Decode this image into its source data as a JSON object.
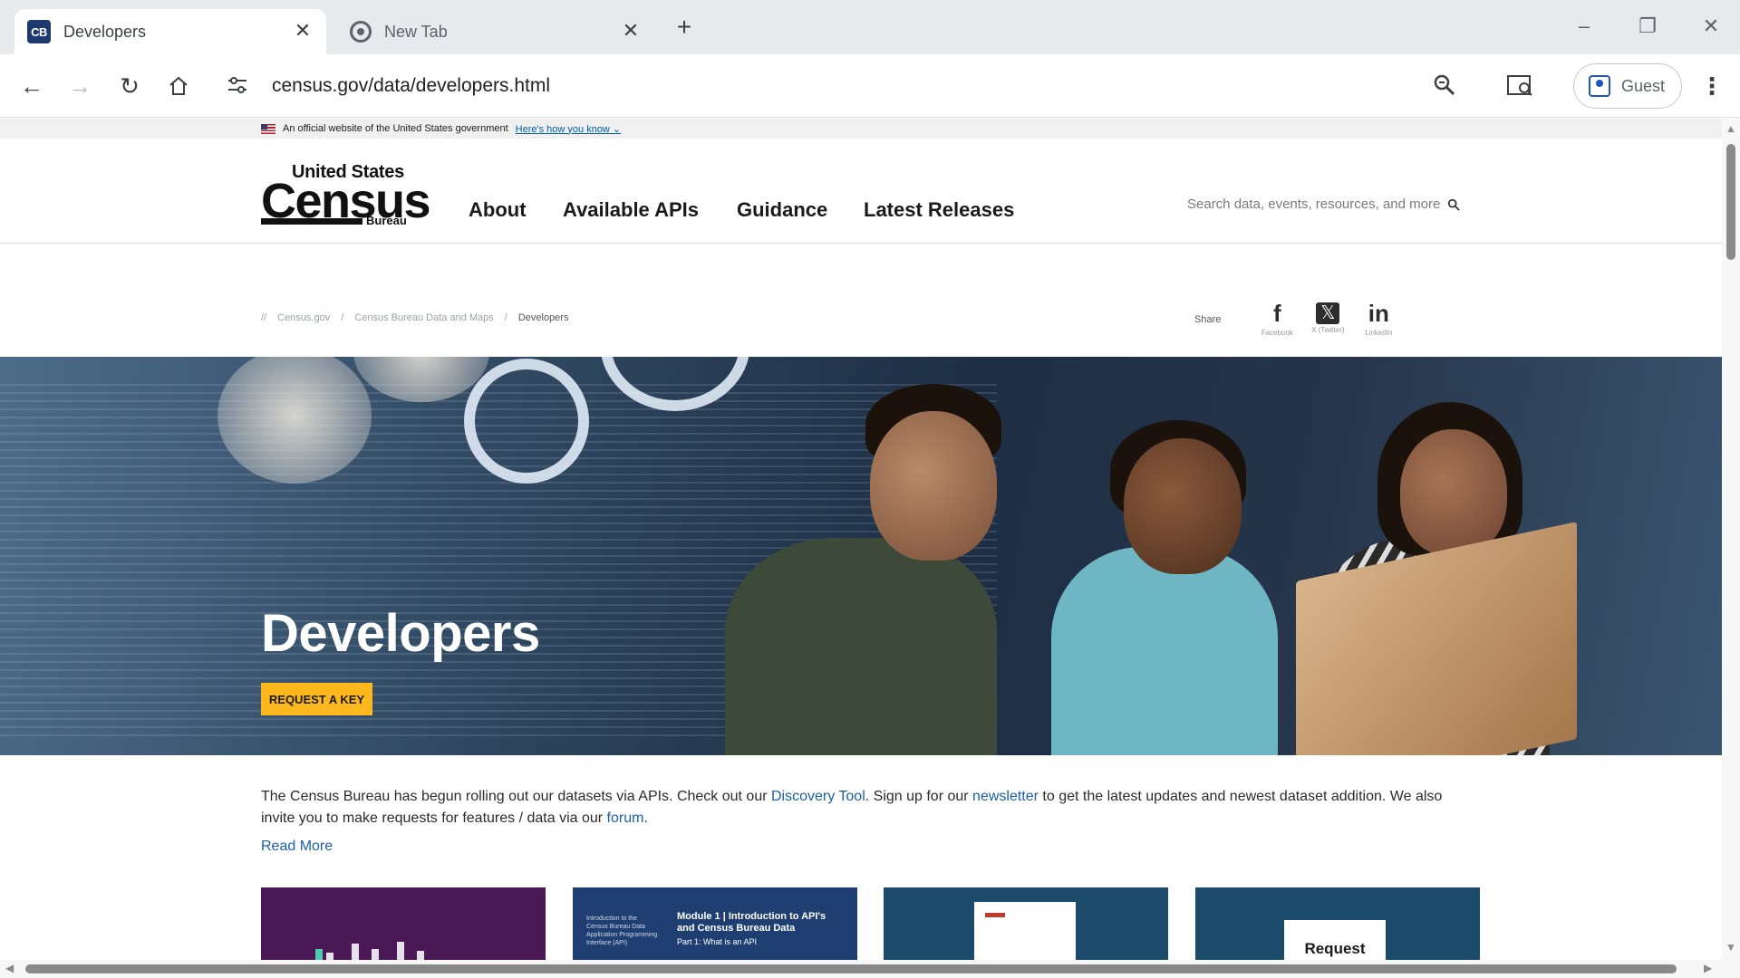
{
  "browser": {
    "tabs": [
      {
        "title": "Developers",
        "favicon": "CB",
        "active": true
      },
      {
        "title": "New Tab",
        "favicon": "chrome-icon",
        "active": false
      }
    ],
    "url": "census.gov/data/developers.html",
    "profile_label": "Guest",
    "colors": {
      "tabstrip": "#e6eaed",
      "accent": "#1a56c4"
    }
  },
  "gov_banner": {
    "text": "An official website of the United States government",
    "link": "Here's how you know ⌄"
  },
  "logo": {
    "line1": "United States",
    "line2": "Census",
    "line3": "Bureau"
  },
  "nav": [
    "About",
    "Available APIs",
    "Guidance",
    "Latest Releases"
  ],
  "search": {
    "placeholder": "Search data, events, resources, and more"
  },
  "breadcrumb": {
    "home_glyph": "//",
    "items": [
      "Census.gov",
      "Census Bureau Data and Maps",
      "Developers"
    ]
  },
  "share": {
    "label": "Share",
    "items": [
      {
        "glyph": "f",
        "label": "Facebook"
      },
      {
        "glyph": "𝕏",
        "label": "X (Twitter)"
      },
      {
        "glyph": "in",
        "label": "LinkedIn"
      }
    ]
  },
  "hero": {
    "title": "Developers",
    "button": "REQUEST A KEY"
  },
  "intro": {
    "part1": "The Census Bureau has begun rolling out our datasets via APIs.  Check out our ",
    "link1": "Discovery Tool",
    "part2": ". Sign up for our ",
    "link2": "newsletter",
    "part3": " to get the latest updates and newest dataset addition. We also invite you to make requests for features / data via our ",
    "link3": "forum",
    "part4": ".",
    "read_more": "Read More"
  },
  "cards": {
    "card2_title": "Module 1 | Introduction to API's and Census Bureau Data",
    "card2_sub": "Part 1: What is an API",
    "card2_side": "Introduction to the Census Bureau Data Application Programming Interface (API)",
    "card4_label": "Request"
  },
  "colors": {
    "hero_button": "#fdb81e",
    "link": "#1a5fa8",
    "card_purple": "#4b1856",
    "card_blue": "#1f3f72"
  }
}
